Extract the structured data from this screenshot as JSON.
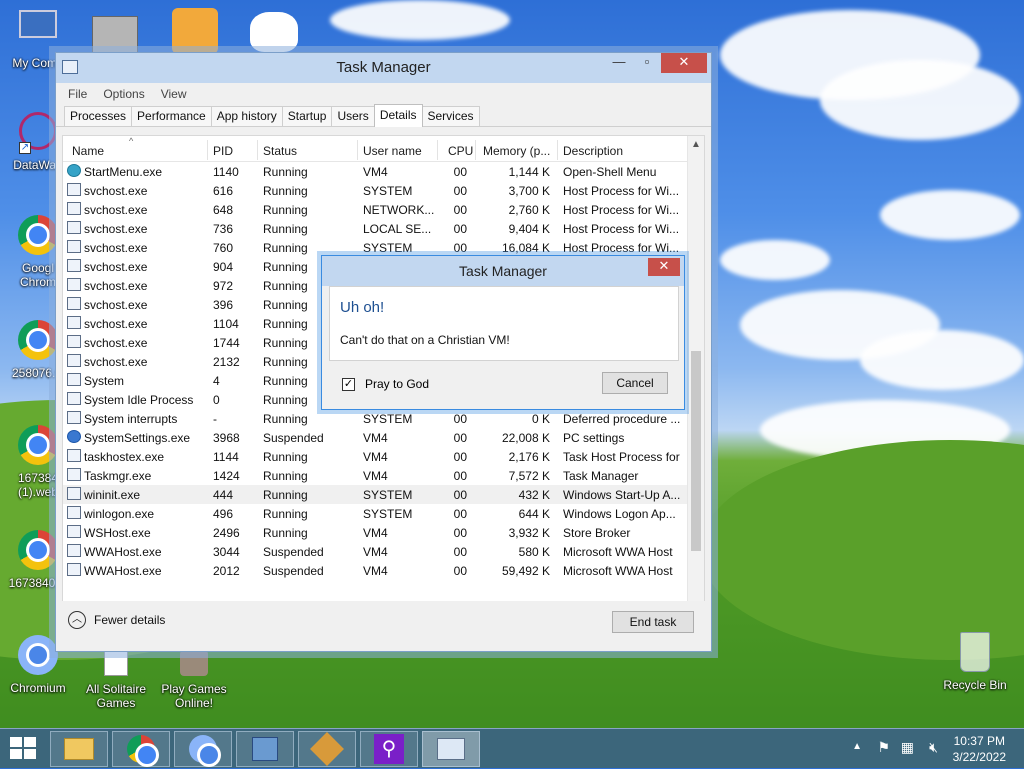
{
  "desktop": {
    "icons": [
      {
        "label": "My Comp"
      },
      {
        "label": "DataWag"
      },
      {
        "label": "Googl\nChrom"
      },
      {
        "label": "258076.w"
      },
      {
        "label": "167384\n(1).web"
      },
      {
        "label": "1673840.w"
      },
      {
        "label": "Chromium"
      },
      {
        "label": "All Solitaire\nGames"
      },
      {
        "label": "Play Games\nOnline!"
      },
      {
        "label": "Recycle Bin"
      }
    ]
  },
  "task_manager": {
    "title": "Task Manager",
    "menu": [
      "File",
      "Options",
      "View"
    ],
    "tabs": [
      "Processes",
      "Performance",
      "App history",
      "Startup",
      "Users",
      "Details",
      "Services"
    ],
    "active_tab": "Details",
    "columns": [
      "Name",
      "PID",
      "Status",
      "User name",
      "CPU",
      "Memory (p...",
      "Description"
    ],
    "rows": [
      {
        "icon": "shell-icon",
        "name": "StartMenu.exe",
        "pid": "1140",
        "status": "Running",
        "user": "VM4",
        "cpu": "00",
        "mem": "1,144 K",
        "desc": "Open-Shell Menu"
      },
      {
        "icon": "process-icon",
        "name": "svchost.exe",
        "pid": "616",
        "status": "Running",
        "user": "SYSTEM",
        "cpu": "00",
        "mem": "3,700 K",
        "desc": "Host Process for Wi..."
      },
      {
        "icon": "process-icon",
        "name": "svchost.exe",
        "pid": "648",
        "status": "Running",
        "user": "NETWORK...",
        "cpu": "00",
        "mem": "2,760 K",
        "desc": "Host Process for Wi..."
      },
      {
        "icon": "process-icon",
        "name": "svchost.exe",
        "pid": "736",
        "status": "Running",
        "user": "LOCAL SE...",
        "cpu": "00",
        "mem": "9,404 K",
        "desc": "Host Process for Wi..."
      },
      {
        "icon": "process-icon",
        "name": "svchost.exe",
        "pid": "760",
        "status": "Running",
        "user": "SYSTEM",
        "cpu": "00",
        "mem": "16,084 K",
        "desc": "Host Process for Wi..."
      },
      {
        "icon": "process-icon",
        "name": "svchost.exe",
        "pid": "904",
        "status": "Running",
        "user": "",
        "cpu": "",
        "mem": "",
        "desc": ""
      },
      {
        "icon": "process-icon",
        "name": "svchost.exe",
        "pid": "972",
        "status": "Running",
        "user": "",
        "cpu": "",
        "mem": "",
        "desc": ""
      },
      {
        "icon": "process-icon",
        "name": "svchost.exe",
        "pid": "396",
        "status": "Running",
        "user": "",
        "cpu": "",
        "mem": "",
        "desc": ""
      },
      {
        "icon": "process-icon",
        "name": "svchost.exe",
        "pid": "1104",
        "status": "Running",
        "user": "",
        "cpu": "",
        "mem": "",
        "desc": ""
      },
      {
        "icon": "process-icon",
        "name": "svchost.exe",
        "pid": "1744",
        "status": "Running",
        "user": "",
        "cpu": "",
        "mem": "",
        "desc": ""
      },
      {
        "icon": "process-icon",
        "name": "svchost.exe",
        "pid": "2132",
        "status": "Running",
        "user": "",
        "cpu": "",
        "mem": "",
        "desc": ""
      },
      {
        "icon": "process-icon",
        "name": "System",
        "pid": "4",
        "status": "Running",
        "user": "",
        "cpu": "",
        "mem": "",
        "desc": ""
      },
      {
        "icon": "process-icon",
        "name": "System Idle Process",
        "pid": "0",
        "status": "Running",
        "user": "",
        "cpu": "",
        "mem": "",
        "desc": ""
      },
      {
        "icon": "process-icon",
        "name": "System interrupts",
        "pid": "-",
        "status": "Running",
        "user": "SYSTEM",
        "cpu": "00",
        "mem": "0 K",
        "desc": "Deferred procedure ..."
      },
      {
        "icon": "gear-icon",
        "name": "SystemSettings.exe",
        "pid": "3968",
        "status": "Suspended",
        "user": "VM4",
        "cpu": "00",
        "mem": "22,008 K",
        "desc": "PC settings"
      },
      {
        "icon": "process-icon",
        "name": "taskhostex.exe",
        "pid": "1144",
        "status": "Running",
        "user": "VM4",
        "cpu": "00",
        "mem": "2,176 K",
        "desc": "Task Host Process for Wi..."
      },
      {
        "icon": "taskmgr-icon",
        "name": "Taskmgr.exe",
        "pid": "1424",
        "status": "Running",
        "user": "VM4",
        "cpu": "00",
        "mem": "7,572 K",
        "desc": "Task Manager"
      },
      {
        "icon": "process-icon",
        "name": "wininit.exe",
        "pid": "444",
        "status": "Running",
        "user": "SYSTEM",
        "cpu": "00",
        "mem": "432 K",
        "desc": "Windows Start-Up A..."
      },
      {
        "icon": "process-icon",
        "name": "winlogon.exe",
        "pid": "496",
        "status": "Running",
        "user": "SYSTEM",
        "cpu": "00",
        "mem": "644 K",
        "desc": "Windows Logon Ap..."
      },
      {
        "icon": "process-icon",
        "name": "WSHost.exe",
        "pid": "2496",
        "status": "Running",
        "user": "VM4",
        "cpu": "00",
        "mem": "3,932 K",
        "desc": "Store Broker"
      },
      {
        "icon": "process-icon",
        "name": "WWAHost.exe",
        "pid": "3044",
        "status": "Suspended",
        "user": "VM4",
        "cpu": "00",
        "mem": "580 K",
        "desc": "Microsoft WWA Host"
      },
      {
        "icon": "process-icon",
        "name": "WWAHost.exe",
        "pid": "2012",
        "status": "Suspended",
        "user": "VM4",
        "cpu": "00",
        "mem": "59,492 K",
        "desc": "Microsoft WWA Host"
      }
    ],
    "fewer_details": "Fewer details",
    "end_task": "End task"
  },
  "dialog": {
    "title": "Task Manager",
    "heading": "Uh oh!",
    "message": "Can't do that on a Christian VM!",
    "checkbox_label": "Pray to God",
    "checkbox_checked": true,
    "cancel": "Cancel"
  },
  "taskbar": {
    "items": [
      "file-explorer-icon",
      "chrome-icon",
      "chromium-icon",
      "control-panel-icon",
      "game-icon",
      "search-app-icon",
      "task-manager-icon"
    ],
    "active_item": "task-manager-icon",
    "time": "10:37 PM",
    "date": "3/22/2022"
  }
}
